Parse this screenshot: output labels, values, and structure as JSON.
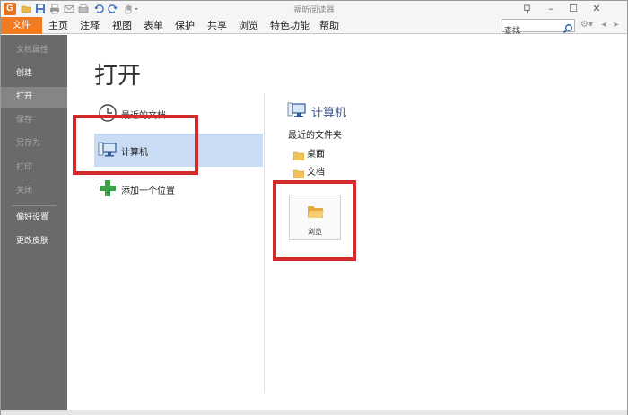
{
  "window": {
    "title": "福昕阅读器",
    "app_logo": "G"
  },
  "quick_access": [
    "open-icon",
    "save-icon",
    "print-icon",
    "email-icon",
    "scan-icon",
    "undo-icon",
    "redo-icon",
    "hand-tool-icon"
  ],
  "menu": {
    "file": "文件",
    "items": [
      "主页",
      "注释",
      "视图",
      "表单",
      "保护",
      "共享",
      "浏览",
      "特色功能",
      "帮助"
    ]
  },
  "search": {
    "value": "查找",
    "placeholder": "查找"
  },
  "sidebar": {
    "items": [
      {
        "label": "文档属性",
        "enabled": false
      },
      {
        "label": "创建",
        "enabled": true
      },
      {
        "label": "打开",
        "enabled": true,
        "active": true
      },
      {
        "label": "保存",
        "enabled": false
      },
      {
        "label": "另存为",
        "enabled": false
      },
      {
        "label": "打印",
        "enabled": false
      },
      {
        "label": "关闭",
        "enabled": false
      },
      {
        "label": "偏好设置",
        "enabled": true
      },
      {
        "label": "更改皮肤",
        "enabled": true
      }
    ]
  },
  "main": {
    "title": "打开",
    "locations": [
      {
        "label": "最近的文档",
        "icon": "clock-icon"
      },
      {
        "label": "计算机",
        "icon": "computer-icon",
        "selected": true
      },
      {
        "label": "添加一个位置",
        "icon": "plus-icon"
      }
    ],
    "computer_panel": {
      "heading": "计算机",
      "recent_folders_label": "最近的文件夹",
      "folders": [
        "桌面",
        "文档"
      ],
      "browse_label": "浏览"
    }
  },
  "colors": {
    "accent": "#f07b22",
    "sidebar_bg": "#6a6a6a",
    "selection": "#c9dcf3",
    "highlight_box": "#d12b2b",
    "heading_blue": "#3d5a8a"
  }
}
